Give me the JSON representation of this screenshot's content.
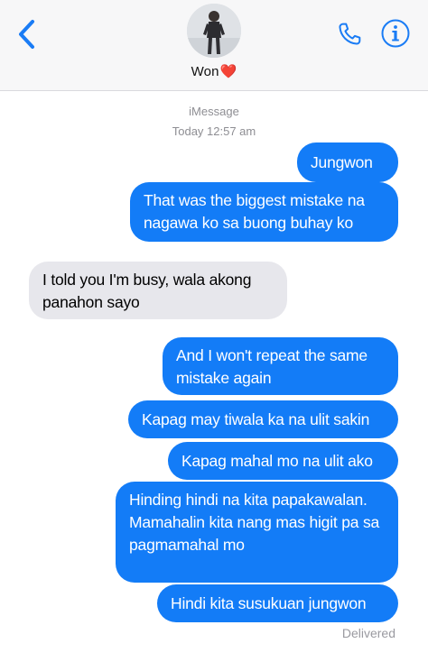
{
  "header": {
    "contact_name": "Won",
    "contact_emoji": "❤️",
    "back_icon": "chevron-left-icon",
    "call_icon": "phone-icon",
    "info_icon": "info-icon"
  },
  "conversation": {
    "service": "iMessage",
    "timestamp": "Today 12:57 am",
    "messages": [
      {
        "direction": "outgoing",
        "text": "Jungwon"
      },
      {
        "direction": "outgoing",
        "text": "That was the biggest mistake na nagawa ko sa buong buhay ko"
      },
      {
        "direction": "incoming",
        "text": "I told you I'm busy, wala akong panahon sayo"
      },
      {
        "direction": "outgoing",
        "text": "And I won't repeat the same mistake again"
      },
      {
        "direction": "outgoing",
        "text": "Kapag may tiwala ka na ulit sakin"
      },
      {
        "direction": "outgoing",
        "text": "Kapag mahal mo na ulit ako"
      },
      {
        "direction": "outgoing",
        "text": "Hinding hindi na kita papakawalan. Mamahalin kita nang mas higit pa sa pagmamahal mo"
      },
      {
        "direction": "outgoing",
        "text": "Hindi kita susukuan jungwon"
      }
    ],
    "status": "Delivered"
  },
  "colors": {
    "outgoing_bubble": "#137cf7",
    "incoming_bubble": "#e7e7ec",
    "accent": "#1a7cf5"
  }
}
